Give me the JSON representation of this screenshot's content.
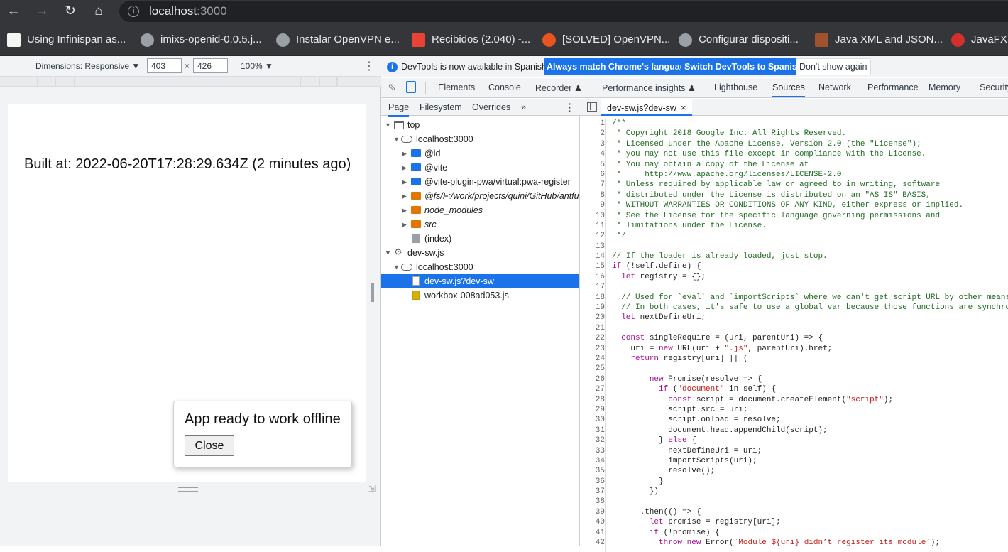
{
  "browser": {
    "url_host": "localhost",
    "url_port": ":3000",
    "bookmarks": [
      {
        "label": "Using Infinispan as...",
        "color": "#ffffff"
      },
      {
        "label": "imixs-openid-0.0.5.j...",
        "color": "#9aa0a6"
      },
      {
        "label": "Instalar OpenVPN e...",
        "color": "#9aa0a6"
      },
      {
        "label": "Recibidos (2.040) -...",
        "color": "#ea4335"
      },
      {
        "label": "[SOLVED] OpenVPN...",
        "color": "#e95420"
      },
      {
        "label": "Configurar dispositi...",
        "color": "#9aa0a6"
      },
      {
        "label": "Java XML and JSON...",
        "color": "#a0522d"
      },
      {
        "label": "JavaFX D",
        "color": "#d32f2f"
      }
    ]
  },
  "device_toolbar": {
    "dimensions_label": "Dimensions: Responsive ▼",
    "width": "403",
    "height": "426",
    "times": "×",
    "zoom": "100% ▼",
    "kebab": "⋮"
  },
  "page": {
    "built_text": "Built at: 2022-06-20T17:28:29.634Z (2 minutes ago)",
    "toast_message": "App ready to work offline",
    "toast_close": "Close"
  },
  "devtools": {
    "info_text": "DevTools is now available in Spanish!",
    "btn_match": "Always match Chrome's language",
    "btn_switch": "Switch DevTools to Spanish",
    "btn_dont_show": "Don't show again",
    "tabs": [
      "Elements",
      "Console",
      "Recorder ♟",
      "Performance insights ♟",
      "Lighthouse",
      "Sources",
      "Network",
      "Performance",
      "Memory",
      "Security"
    ],
    "active_tab": "Sources",
    "nav_tabs": [
      "Page",
      "Filesystem",
      "Overrides",
      "»"
    ],
    "tree": [
      {
        "label": "top"
      },
      {
        "label": "localhost:3000"
      },
      {
        "label": "@id"
      },
      {
        "label": "@vite"
      },
      {
        "label": "@vite-plugin-pwa/virtual:pwa-register"
      },
      {
        "label": "@fs/F:/work/projects/quini/GitHub/antfu/"
      },
      {
        "label": "node_modules"
      },
      {
        "label": "src"
      },
      {
        "label": "(index)"
      },
      {
        "label": "dev-sw.js"
      },
      {
        "label": "localhost:3000"
      },
      {
        "label": "dev-sw.js?dev-sw"
      },
      {
        "label": "workbox-008ad053.js"
      }
    ],
    "editor_tab": "dev-sw.js?dev-sw",
    "editor_close": "×",
    "code": [
      "/**",
      " * Copyright 2018 Google Inc. All Rights Reserved.",
      " * Licensed under the Apache License, Version 2.0 (the \"License\");",
      " * you may not use this file except in compliance with the License.",
      " * You may obtain a copy of the License at",
      " *     http://www.apache.org/licenses/LICENSE-2.0",
      " * Unless required by applicable law or agreed to in writing, software",
      " * distributed under the License is distributed on an \"AS IS\" BASIS,",
      " * WITHOUT WARRANTIES OR CONDITIONS OF ANY KIND, either express or implied.",
      " * See the License for the specific language governing permissions and",
      " * limitations under the License.",
      " */",
      "",
      "// If the loader is already loaded, just stop.",
      "if (!self.define) {",
      "  let registry = {};",
      "",
      "  // Used for `eval` and `importScripts` where we can't get script URL by other means.",
      "  // In both cases, it's safe to use a global var because those functions are synchronous.",
      "  let nextDefineUri;",
      "",
      "  const singleRequire = (uri, parentUri) => {",
      "    uri = new URL(uri + \".js\", parentUri).href;",
      "    return registry[uri] || (",
      "",
      "        new Promise(resolve => {",
      "          if (\"document\" in self) {",
      "            const script = document.createElement(\"script\");",
      "            script.src = uri;",
      "            script.onload = resolve;",
      "            document.head.appendChild(script);",
      "          } else {",
      "            nextDefineUri = uri;",
      "            importScripts(uri);",
      "            resolve();",
      "          }",
      "        })",
      "",
      "      .then(() => {",
      "        let promise = registry[uri];",
      "        if (!promise) {",
      "          throw new Error(`Module ${uri} didn’t register its module`);"
    ]
  }
}
